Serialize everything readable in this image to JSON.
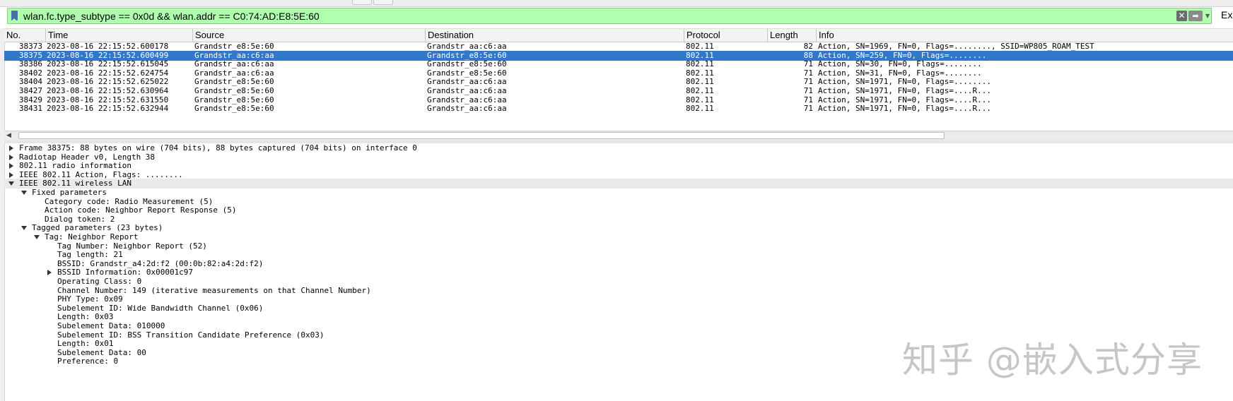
{
  "filter": {
    "value": "wlan.fc.type_subtype == 0x0d && wlan.addr == C0:74:AD:E8:5E:60",
    "expression_label": "Ex"
  },
  "columns": [
    "No.",
    "Time",
    "Source",
    "Destination",
    "Protocol",
    "Length",
    "Info"
  ],
  "packets": [
    {
      "no": "38373",
      "time": "2023-08-16 22:15:52.600178",
      "source": "Grandstr_e8:5e:60",
      "destination": "Grandstr_aa:c6:aa",
      "protocol": "802.11",
      "length": "82",
      "info": "Action, SN=1969, FN=0, Flags=........, SSID=WP805_ROAM_TEST"
    },
    {
      "no": "38375",
      "time": "2023-08-16 22:15:52.600499",
      "source": "Grandstr_aa:c6:aa",
      "destination": "Grandstr_e8:5e:60",
      "protocol": "802.11",
      "length": "88",
      "info": "Action, SN=259, FN=0, Flags=........"
    },
    {
      "no": "38386",
      "time": "2023-08-16 22:15:52.615045",
      "source": "Grandstr_aa:c6:aa",
      "destination": "Grandstr_e8:5e:60",
      "protocol": "802.11",
      "length": "71",
      "info": "Action, SN=30, FN=0, Flags=........"
    },
    {
      "no": "38402",
      "time": "2023-08-16 22:15:52.624754",
      "source": "Grandstr_aa:c6:aa",
      "destination": "Grandstr_e8:5e:60",
      "protocol": "802.11",
      "length": "71",
      "info": "Action, SN=31, FN=0, Flags=........"
    },
    {
      "no": "38404",
      "time": "2023-08-16 22:15:52.625022",
      "source": "Grandstr_e8:5e:60",
      "destination": "Grandstr_aa:c6:aa",
      "protocol": "802.11",
      "length": "71",
      "info": "Action, SN=1971, FN=0, Flags=........"
    },
    {
      "no": "38427",
      "time": "2023-08-16 22:15:52.630964",
      "source": "Grandstr_e8:5e:60",
      "destination": "Grandstr_aa:c6:aa",
      "protocol": "802.11",
      "length": "71",
      "info": "Action, SN=1971, FN=0, Flags=....R..."
    },
    {
      "no": "38429",
      "time": "2023-08-16 22:15:52.631550",
      "source": "Grandstr_e8:5e:60",
      "destination": "Grandstr_aa:c6:aa",
      "protocol": "802.11",
      "length": "71",
      "info": "Action, SN=1971, FN=0, Flags=....R..."
    },
    {
      "no": "38431",
      "time": "2023-08-16 22:15:52.632944",
      "source": "Grandstr_e8:5e:60",
      "destination": "Grandstr_aa:c6:aa",
      "protocol": "802.11",
      "length": "71",
      "info": "Action, SN=1971, FN=0, Flags=....R..."
    }
  ],
  "selected_packet": "38375",
  "details": [
    {
      "level": 0,
      "expander": "collapsed",
      "text": "Frame 38375: 88 bytes on wire (704 bits), 88 bytes captured (704 bits) on interface 0"
    },
    {
      "level": 0,
      "expander": "collapsed",
      "text": "Radiotap Header v0, Length 38"
    },
    {
      "level": 0,
      "expander": "collapsed",
      "text": "802.11 radio information"
    },
    {
      "level": 0,
      "expander": "collapsed",
      "text": "IEEE 802.11 Action, Flags: ........"
    },
    {
      "level": 0,
      "expander": "expanded",
      "text": "IEEE 802.11 wireless LAN",
      "highlight": true
    },
    {
      "level": 1,
      "expander": "expanded",
      "text": "Fixed parameters"
    },
    {
      "level": 2,
      "expander": "none",
      "text": "Category code: Radio Measurement (5)"
    },
    {
      "level": 2,
      "expander": "none",
      "text": "Action code: Neighbor Report Response (5)"
    },
    {
      "level": 2,
      "expander": "none",
      "text": "Dialog token: 2"
    },
    {
      "level": 1,
      "expander": "expanded",
      "text": "Tagged parameters (23 bytes)"
    },
    {
      "level": 2,
      "expander": "expanded",
      "text": "Tag: Neighbor Report"
    },
    {
      "level": 3,
      "expander": "none",
      "text": "Tag Number: Neighbor Report (52)"
    },
    {
      "level": 3,
      "expander": "none",
      "text": "Tag length: 21"
    },
    {
      "level": 3,
      "expander": "none",
      "text": "BSSID: Grandstr_a4:2d:f2 (00:0b:82:a4:2d:f2)"
    },
    {
      "level": 3,
      "expander": "collapsed",
      "text": "BSSID Information: 0x00001c97"
    },
    {
      "level": 3,
      "expander": "none",
      "text": "Operating Class: 0"
    },
    {
      "level": 3,
      "expander": "none",
      "text": "Channel Number: 149 (iterative measurements on that Channel Number)"
    },
    {
      "level": 3,
      "expander": "none",
      "text": "PHY Type: 0x09"
    },
    {
      "level": 3,
      "expander": "none",
      "text": "Subelement ID: Wide Bandwidth Channel (0x06)"
    },
    {
      "level": 3,
      "expander": "none",
      "text": "Length: 0x03"
    },
    {
      "level": 3,
      "expander": "none",
      "text": "Subelement Data: 010000"
    },
    {
      "level": 3,
      "expander": "none",
      "text": "Subelement ID: BSS Transition Candidate Preference (0x03)"
    },
    {
      "level": 3,
      "expander": "none",
      "text": "Length: 0x01"
    },
    {
      "level": 3,
      "expander": "none",
      "text": "Subelement Data: 00"
    },
    {
      "level": 3,
      "expander": "none",
      "text": "Preference: 0"
    }
  ],
  "watermark": "知乎 @嵌入式分享",
  "icons": {
    "bookmark": "bookmark-icon",
    "clear": "clear-icon",
    "apply": "arrow-right-icon",
    "dropdown": "chevron-down-icon"
  },
  "colors": {
    "filter_bg": "#afffaf",
    "selection": "#3277ca"
  }
}
